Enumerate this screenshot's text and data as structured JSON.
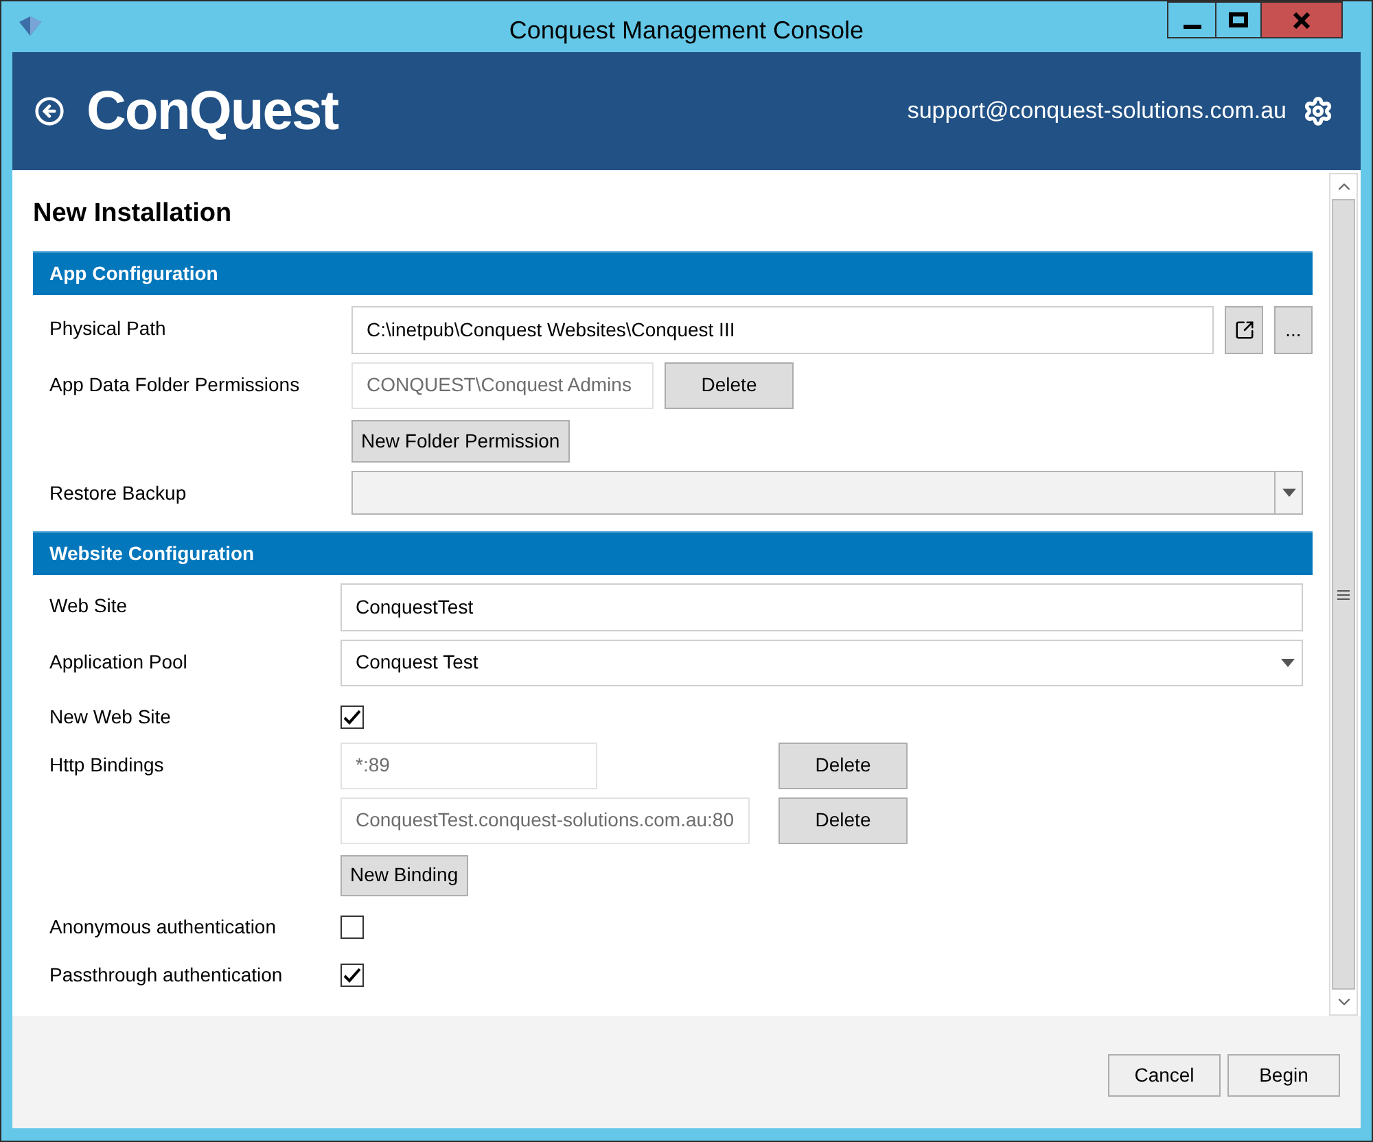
{
  "window": {
    "title": "Conquest Management Console"
  },
  "header": {
    "logo": "ConQuest",
    "email": "support@conquest-solutions.com.au"
  },
  "page_title": "New Installation",
  "app_configuration": {
    "heading": "App Configuration",
    "physical_path": {
      "label": "Physical Path",
      "value": "C:\\inetpub\\Conquest Websites\\Conquest III",
      "browse_button": "..."
    },
    "folder_permissions": {
      "label": "App Data Folder Permissions",
      "entries": [
        {
          "value": "CONQUEST\\Conquest Admins",
          "delete_button": "Delete"
        }
      ],
      "new_button": "New Folder Permission"
    },
    "restore_backup": {
      "label": "Restore Backup",
      "disabled": true
    }
  },
  "website_configuration": {
    "heading": "Website Configuration",
    "web_site": {
      "label": "Web Site",
      "value": "ConquestTest"
    },
    "application_pool": {
      "label": "Application Pool",
      "value": "Conquest Test"
    },
    "new_web_site": {
      "label": "New Web Site",
      "checked": true
    },
    "http_bindings": {
      "label": "Http Bindings",
      "entries": [
        {
          "value": "*:89",
          "delete_button": "Delete"
        },
        {
          "value": "ConquestTest.conquest-solutions.com.au:80",
          "delete_button": "Delete"
        }
      ],
      "new_button": "New Binding"
    },
    "anonymous_authentication": {
      "label": "Anonymous authentication",
      "checked": false
    },
    "passthrough_authentication": {
      "label": "Passthrough authentication",
      "checked": true
    }
  },
  "buttons": [
    "Cancel",
    "Begin"
  ]
}
